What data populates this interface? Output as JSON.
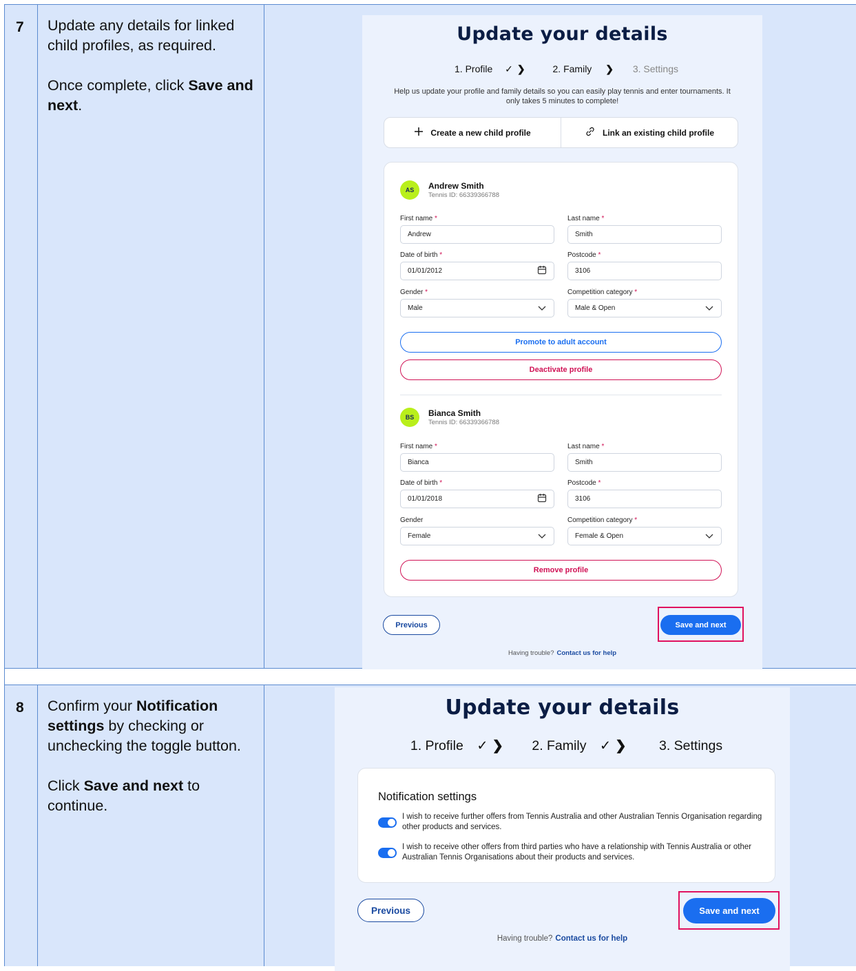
{
  "rows": [
    {
      "step": "7",
      "instructions": [
        [
          {
            "t": "Update any details for linked child profiles, as required."
          }
        ],
        [
          {
            "t": "Once complete, click "
          },
          {
            "t": "Save and next",
            "b": true
          },
          {
            "t": "."
          }
        ]
      ]
    },
    {
      "step": "8",
      "instructions": [
        [
          {
            "t": "Confirm your "
          },
          {
            "t": "Notification settings",
            "b": true
          },
          {
            "t": " by checking or unchecking the toggle button."
          }
        ],
        [
          {
            "t": "Click "
          },
          {
            "t": "Save and next",
            "b": true
          },
          {
            "t": " to continue."
          }
        ]
      ]
    }
  ],
  "shot1": {
    "title": "Update your details",
    "steps": {
      "s1": "1. Profile",
      "s1_check": "✓",
      "s1_chev": "❯",
      "s2": "2. Family",
      "s2_chev": "❯",
      "s3": "3. Settings"
    },
    "help_text": "Help us update your profile and family details so you can easily play tennis and enter tournaments. It only takes 5 minutes to complete!",
    "tabs": {
      "create": "Create a new child profile",
      "create_icon": "plus-icon",
      "link": "Link an existing child profile",
      "link_icon": "link-icon"
    },
    "profiles": [
      {
        "initials": "AS",
        "name": "Andrew Smith",
        "tennis_id": "Tennis ID: 66339366788",
        "first_name_label": "First name",
        "first_name": "Andrew",
        "last_name_label": "Last name",
        "last_name": "Smith",
        "dob_label": "Date of birth",
        "dob": "01/01/2012",
        "postcode_label": "Postcode",
        "postcode": "3106",
        "gender_label": "Gender",
        "gender": "Male",
        "category_label": "Competition category",
        "category": "Male & Open",
        "promote_label": "Promote to adult account",
        "deactivate_label": "Deactivate profile"
      },
      {
        "initials": "BS",
        "name": "Bianca Smith",
        "tennis_id": "Tennis ID: 66339366788",
        "first_name_label": "First name",
        "first_name": "Bianca",
        "last_name_label": "Last name",
        "last_name": "Smith",
        "dob_label": "Date of birth",
        "dob": "01/01/2018",
        "postcode_label": "Postcode",
        "postcode": "3106",
        "gender_label": "Gender",
        "gender": "Female",
        "category_label": "Competition category",
        "category": "Female & Open",
        "remove_label": "Remove profile"
      }
    ],
    "required_mark": "*",
    "previous_label": "Previous",
    "save_label": "Save and next",
    "trouble_text": "Having trouble?",
    "contact_link": "Contact us for help"
  },
  "shot2": {
    "title": "Update your details",
    "steps": {
      "s1": "1. Profile",
      "s1_check": "✓",
      "s1_chev": "❯",
      "s2": "2. Family",
      "s2_check": "✓",
      "s2_chev": "❯",
      "s3": "3. Settings"
    },
    "notification_title": "Notification settings",
    "toggles": [
      {
        "on": true,
        "text": "I wish to receive further offers from Tennis Australia and other Australian Tennis Organisation regarding other products and services."
      },
      {
        "on": true,
        "text": "I wish to receive other offers from third parties who have a relationship with Tennis Australia or other Australian Tennis Organisations about their products and services."
      }
    ],
    "previous_label": "Previous",
    "save_label": "Save and next",
    "trouble_text": "Having trouble?",
    "contact_link": "Contact us for help"
  },
  "colors": {
    "accent": "#1a6ef0",
    "danger": "#d01255",
    "highlight": "#e0115f",
    "avatar": "#b9ef1b",
    "row_bg": "#d9e6fb"
  }
}
